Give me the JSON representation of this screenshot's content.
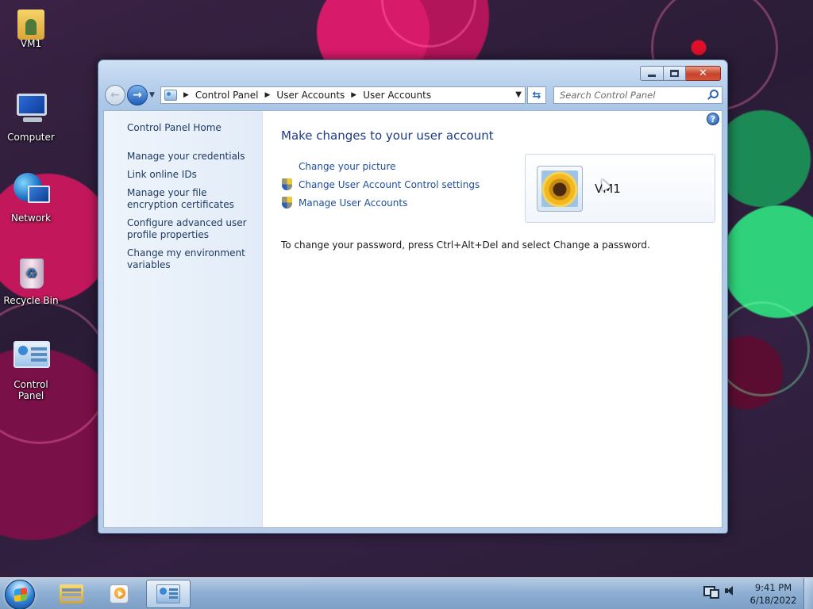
{
  "desktop": {
    "icons": [
      {
        "label": "VM1"
      },
      {
        "label": "Computer"
      },
      {
        "label": "Network"
      },
      {
        "label": "Recycle Bin"
      },
      {
        "label": "Control Panel"
      }
    ]
  },
  "window": {
    "address": {
      "crumbs": [
        "Control Panel",
        "User Accounts",
        "User Accounts"
      ]
    },
    "search": {
      "placeholder": "Search Control Panel"
    },
    "sidebar": {
      "home": "Control Panel Home",
      "links": [
        "Manage your credentials",
        "Link online IDs",
        "Manage your file encryption certificates",
        "Configure advanced user profile properties",
        "Change my environment variables"
      ]
    },
    "main": {
      "title": "Make changes to your user account",
      "tasks": [
        {
          "label": "Change your picture",
          "icon": "none"
        },
        {
          "label": "Change User Account Control settings",
          "icon": "uac-shield-icon"
        },
        {
          "label": "Manage User Accounts",
          "icon": "uac-shield-icon"
        }
      ],
      "note": "To change your password, press Ctrl+Alt+Del and select Change a password.",
      "account": {
        "name": "VM1",
        "picture": "sunflower"
      }
    }
  },
  "taskbar": {
    "clock": {
      "time": "9:41 PM",
      "date": "6/18/2022"
    }
  },
  "colors": {
    "link": "#1e4d9c",
    "title": "#1e3a8a",
    "taskbar": "#8fb0d3"
  }
}
